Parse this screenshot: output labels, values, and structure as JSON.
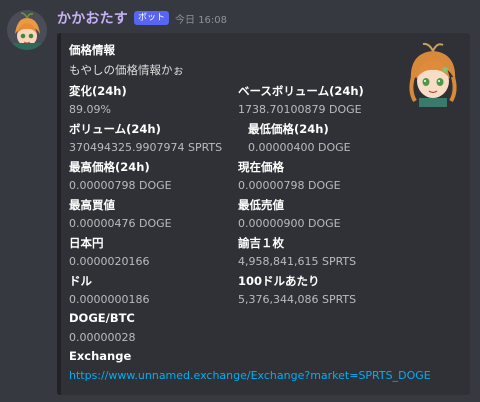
{
  "message": {
    "username": "かかおたす",
    "bot_badge": "ボット",
    "timestamp": "今日 16:08"
  },
  "embed": {
    "title": "価格情報",
    "description": "もやしの価格情報かぉ",
    "fields": [
      {
        "name": "変化(24h)",
        "value": "89.09%"
      },
      {
        "name": "ベースボリューム(24h)",
        "value": "1738.70100879 DOGE"
      },
      {
        "name": "ボリューム(24h)",
        "value": "370494325.9907974 SPRTS"
      },
      {
        "name": "最低価格(24h)",
        "value": "0.00000400 DOGE"
      },
      {
        "name": "最高価格(24h)",
        "value": "0.00000798 DOGE"
      },
      {
        "name": "現在価格",
        "value": "0.00000798 DOGE"
      },
      {
        "name": "最高買値",
        "value": "0.00000476 DOGE"
      },
      {
        "name": "最低売値",
        "value": "0.00000900 DOGE"
      },
      {
        "name": "日本円",
        "value": "0.0000020166"
      },
      {
        "name": "諭吉１枚",
        "value": "4,958,841,615 SPRTS"
      },
      {
        "name": "ドル",
        "value": "0.0000000186"
      },
      {
        "name": "100ドルあたり",
        "value": "5,376,344,086 SPRTS"
      },
      {
        "name": "DOGE/BTC",
        "value": "0.00000028"
      },
      {
        "name": "Exchange",
        "value": "https://www.unnamed.exchange/Exchange?market=SPRTS_DOGE"
      }
    ]
  },
  "colors": {
    "background": "#36393f",
    "embed_background": "#2f3136",
    "username": "#c7b0f5",
    "bot_badge": "#5865f2",
    "link": "#00aff4"
  }
}
